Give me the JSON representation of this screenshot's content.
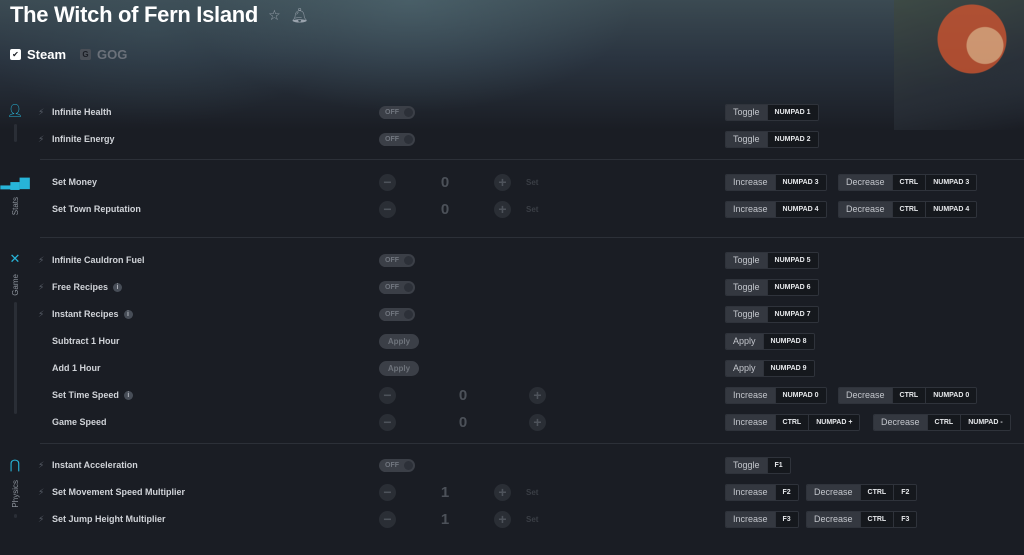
{
  "game": {
    "title": "The Witch of Fern Island",
    "platforms": [
      {
        "name": "Steam",
        "icon": "steam-icon",
        "active": true
      },
      {
        "name": "GOG",
        "icon": "gog-icon",
        "active": false
      }
    ]
  },
  "categories": [
    {
      "name": "",
      "icon": "person-icon"
    },
    {
      "name": "Stats",
      "icon": "bar-chart-icon"
    },
    {
      "name": "Game",
      "icon": "crossed-tools-icon"
    },
    {
      "name": "Physics",
      "icon": "magnet-icon"
    }
  ],
  "labels": {
    "off": "OFF",
    "apply": "Apply",
    "set": "Set",
    "toggle": "Toggle",
    "increase": "Increase",
    "decrease": "Decrease",
    "apply_key": "Apply",
    "ctrl": "CTRL"
  },
  "cheats": {
    "infinite_health": {
      "label": "Infinite Health",
      "key": "NUMPAD 1"
    },
    "infinite_energy": {
      "label": "Infinite Energy",
      "key": "NUMPAD 2"
    },
    "set_money": {
      "label": "Set Money",
      "value": "0",
      "inc_key": "NUMPAD 3",
      "dec_key": "NUMPAD 3"
    },
    "set_town_reputation": {
      "label": "Set Town Reputation",
      "value": "0",
      "inc_key": "NUMPAD 4",
      "dec_key": "NUMPAD 4"
    },
    "infinite_cauldron_fuel": {
      "label": "Infinite Cauldron Fuel",
      "key": "NUMPAD 5"
    },
    "free_recipes": {
      "label": "Free Recipes",
      "key": "NUMPAD 6"
    },
    "instant_recipes": {
      "label": "Instant Recipes",
      "key": "NUMPAD 7"
    },
    "subtract_1_hour": {
      "label": "Subtract 1 Hour",
      "key": "NUMPAD 8"
    },
    "add_1_hour": {
      "label": "Add 1 Hour",
      "key": "NUMPAD 9"
    },
    "set_time_speed": {
      "label": "Set Time Speed",
      "value": "0",
      "inc_key": "NUMPAD 0",
      "dec_key": "NUMPAD 0"
    },
    "game_speed": {
      "label": "Game Speed",
      "value": "0",
      "inc_key": "NUMPAD +",
      "dec_key": "NUMPAD -"
    },
    "instant_acceleration": {
      "label": "Instant Acceleration",
      "key": "F1"
    },
    "set_movement_speed_multiplier": {
      "label": "Set Movement Speed Multiplier",
      "value": "1",
      "inc_key": "F2",
      "dec_key": "F2"
    },
    "set_jump_height_multiplier": {
      "label": "Set Jump Height Multiplier",
      "value": "1",
      "inc_key": "F3",
      "dec_key": "F3"
    }
  },
  "colors": {
    "accent": "#27b4d8",
    "background": "#1a1d24"
  }
}
